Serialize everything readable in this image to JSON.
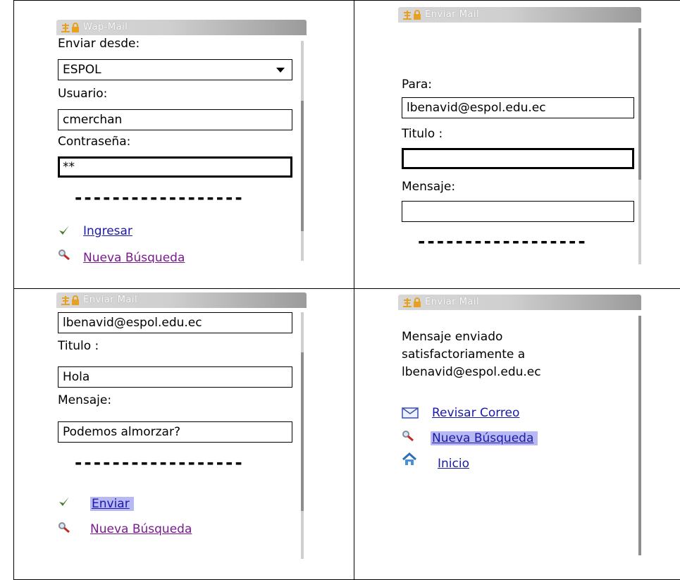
{
  "panel1": {
    "title": "Wap-Mail",
    "send_from_label": "Enviar desde:",
    "send_from_value": "ESPOL",
    "user_label": "Usuario:",
    "user_value": "cmerchan",
    "password_label": "Contraseña:",
    "password_value": "**",
    "separator": "------------------",
    "login_link": "Ingresar",
    "search_link": "Nueva Búsqueda"
  },
  "panel2": {
    "title": "Enviar Mail",
    "to_label": "Para:",
    "to_value": "lbenavid@espol.edu.ec",
    "subject_label": "Titulo :",
    "subject_value": "",
    "message_label": "Mensaje:",
    "message_value": "",
    "separator": "------------------"
  },
  "panel3": {
    "title": "Enviar Mail",
    "to_value": "lbenavid@espol.edu.ec",
    "subject_label": "Titulo :",
    "subject_value": "Hola",
    "message_label": "Mensaje:",
    "message_value": "Podemos almorzar?",
    "separator": "------------------",
    "send_link": "Enviar",
    "search_link": "Nueva Búsqueda"
  },
  "panel4": {
    "title": "Enviar Mail",
    "message_line1": "Mensaje enviado",
    "message_line2": "satisfactoriamente a",
    "message_line3": "lbenavid@espol.edu.ec",
    "check_mail_link": "Revisar Correo",
    "search_link": "Nueva Búsqueda",
    "home_link": "Inicio"
  },
  "icons": {
    "title_antenna": "antenna-icon",
    "title_lock": "lock-icon",
    "check": "checkmark-icon",
    "search": "magnifier-icon",
    "mail": "envelope-icon",
    "home": "home-icon"
  },
  "colors": {
    "link_blue": "#1a1aa8",
    "link_visited": "#7a1a8e",
    "highlight": "#b8b8f3",
    "check_green": "#4a7a2a",
    "title_icon_orange": "#e8a020"
  }
}
